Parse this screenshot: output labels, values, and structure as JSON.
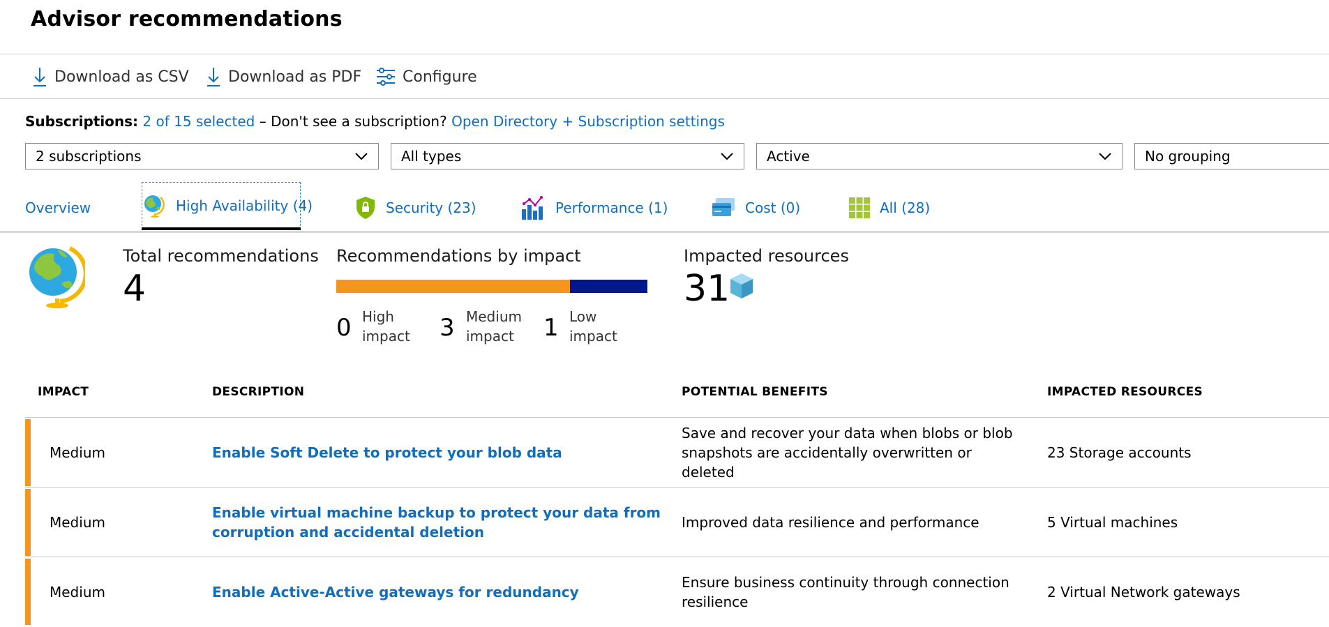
{
  "page": {
    "title": "Advisor recommendations"
  },
  "toolbar": {
    "download_csv": "Download as CSV",
    "download_pdf": "Download as PDF",
    "configure": "Configure"
  },
  "subscriptions": {
    "label": "Subscriptions:",
    "selected": "2 of 15 selected",
    "prompt": "– Don't see a subscription?",
    "settings_link": "Open Directory + Subscription settings"
  },
  "filters": {
    "subscriptions": "2 subscriptions",
    "types": "All types",
    "status": "Active",
    "grouping": "No grouping"
  },
  "tabs": [
    {
      "label": "Overview",
      "icon": "none"
    },
    {
      "label": "High Availability (4)",
      "icon": "globe-icon"
    },
    {
      "label": "Security (23)",
      "icon": "shield-lock-icon"
    },
    {
      "label": "Performance (1)",
      "icon": "bar-chart-icon"
    },
    {
      "label": "Cost (0)",
      "icon": "credit-card-icon"
    },
    {
      "label": "All (28)",
      "icon": "grid-icon"
    }
  ],
  "summary": {
    "total_label": "Total recommendations",
    "total_value": "4",
    "impact_label": "Recommendations by impact",
    "impact_bar": {
      "medium_fraction": 0.75,
      "low_fraction": 0.25,
      "medium_color": "#f7941d",
      "low_color": "#00188f"
    },
    "high_count": "0",
    "high_label_1": "High",
    "high_label_2": "impact",
    "medium_count": "3",
    "medium_label_1": "Medium",
    "medium_label_2": "impact",
    "low_count": "1",
    "low_label_1": "Low",
    "low_label_2": "impact",
    "resources_label": "Impacted resources",
    "resources_value": "31"
  },
  "table": {
    "headers": {
      "impact": "IMPACT",
      "description": "DESCRIPTION",
      "benefits": "POTENTIAL BENEFITS",
      "resources": "IMPACTED RESOURCES"
    },
    "rows": [
      {
        "impact": "Medium",
        "description": "Enable Soft Delete to protect your blob data",
        "benefits": "Save and recover your data when blobs or blob snapshots are accidentally overwritten or deleted",
        "resources": "23 Storage accounts"
      },
      {
        "impact": "Medium",
        "description": "Enable virtual machine backup to protect your data from corruption and accidental deletion",
        "benefits": "Improved data resilience and performance",
        "resources": "5 Virtual machines"
      },
      {
        "impact": "Medium",
        "description": "Enable Active-Active gateways for redundancy",
        "benefits": "Ensure business continuity through connection resilience",
        "resources": "2 Virtual Network gateways"
      }
    ]
  },
  "colors": {
    "accent": "#106ebe",
    "medium_impact": "#f7941d",
    "low_impact": "#00188f"
  }
}
